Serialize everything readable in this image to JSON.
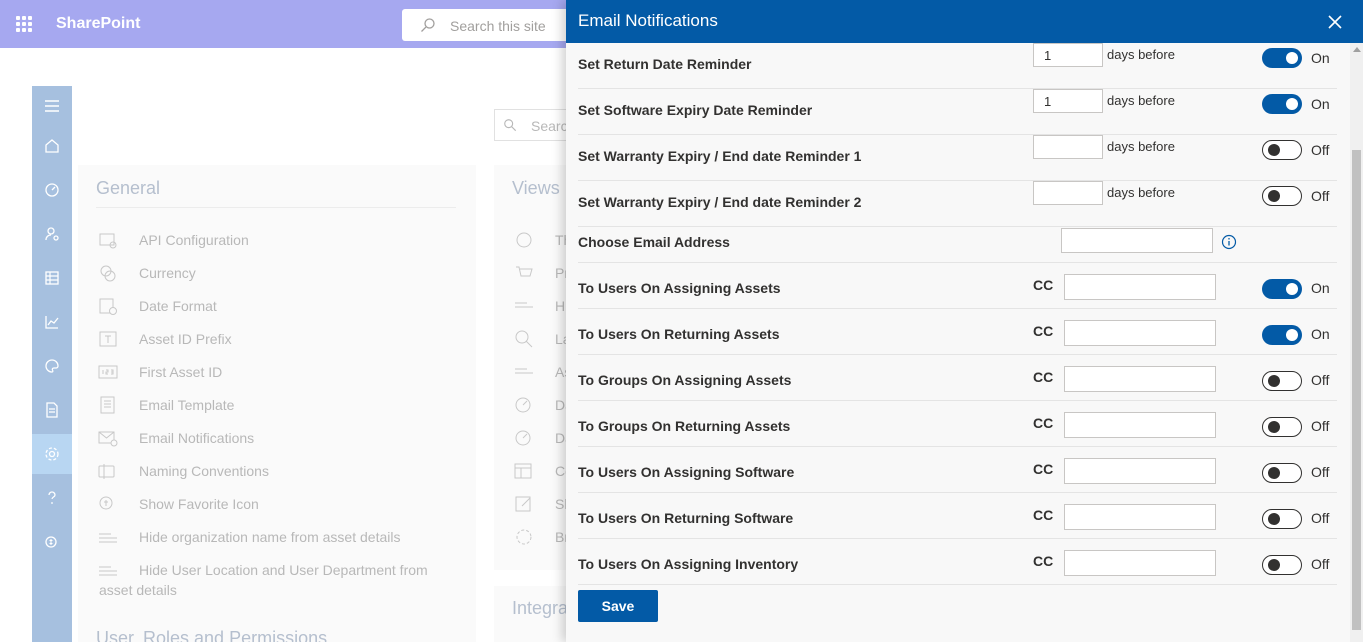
{
  "app": {
    "title": "SharePoint",
    "search_placeholder": "Search this site"
  },
  "rail": [
    "menu-icon",
    "home-icon",
    "dashboard-icon",
    "users-settings-icon",
    "table-icon",
    "chart-icon",
    "palette-icon",
    "report-icon",
    "settings-icon",
    "help-icon",
    "licensing-icon"
  ],
  "general": {
    "title": "General",
    "items": [
      {
        "label": "API Configuration",
        "icon": "api-config-icon"
      },
      {
        "label": "Currency",
        "icon": "currency-icon"
      },
      {
        "label": "Date Format",
        "icon": "date-format-icon"
      },
      {
        "label": "Asset ID Prefix",
        "icon": "prefix-icon"
      },
      {
        "label": "First Asset ID",
        "icon": "number-icon"
      },
      {
        "label": "Email Template",
        "icon": "template-icon"
      },
      {
        "label": "Email Notifications",
        "icon": "email-settings-icon"
      },
      {
        "label": "Naming Conventions",
        "icon": "naming-icon"
      },
      {
        "label": "Show Favorite Icon",
        "icon": "favorite-icon"
      },
      {
        "label": "Hide organization name from asset details",
        "icon": "hide-lines-icon"
      },
      {
        "label": "Hide User Location and User Department from",
        "label2": "asset details",
        "icon": "hide-lines-icon"
      }
    ],
    "next_title": "User, Roles and Permissions"
  },
  "views": {
    "title": "Views",
    "search_placeholder": "Search",
    "items": [
      "Th",
      "Pr",
      "Hi",
      "La",
      "As",
      "Da",
      "Da",
      "Co",
      "Sh",
      "Br"
    ],
    "next_title": "Integra"
  },
  "panel": {
    "title": "Email Notifications",
    "days_label": "days before",
    "cc_label": "CC",
    "reminders": [
      {
        "label": "Set Return Date Reminder",
        "days": "1",
        "state": "On"
      },
      {
        "label": "Set Software Expiry Date Reminder",
        "days": "1",
        "state": "On"
      },
      {
        "label": "Set Warranty Expiry / End date Reminder 1",
        "days": "",
        "state": "Off"
      },
      {
        "label": "Set Warranty Expiry / End date Reminder 2",
        "days": "",
        "state": "Off"
      }
    ],
    "email_address": {
      "label": "Choose Email Address",
      "value": ""
    },
    "notifications": [
      {
        "label": "To Users On Assigning Assets",
        "state": "On"
      },
      {
        "label": "To Users On Returning Assets",
        "state": "On"
      },
      {
        "label": "To Groups On Assigning Assets",
        "state": "Off"
      },
      {
        "label": "To Groups On Returning Assets",
        "state": "Off"
      },
      {
        "label": "To Users On Assigning Software",
        "state": "Off"
      },
      {
        "label": "To Users On Returning Software",
        "state": "Off"
      },
      {
        "label": "To Users On Assigning Inventory",
        "state": "Off"
      }
    ],
    "save_label": "Save"
  }
}
